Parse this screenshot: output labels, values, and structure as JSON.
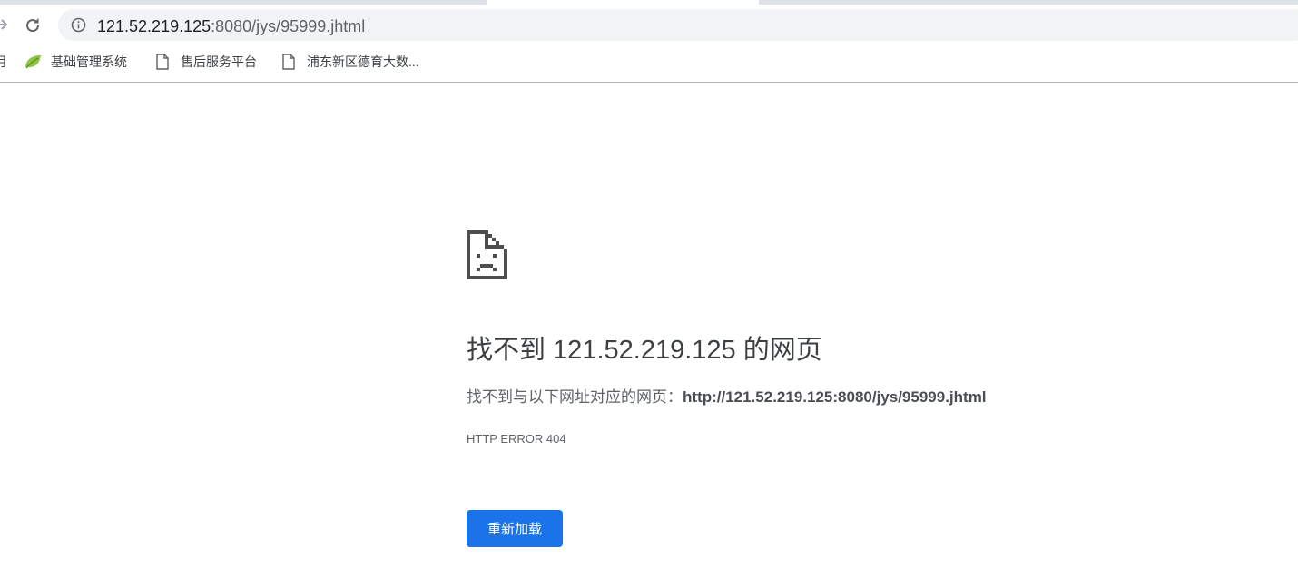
{
  "browser": {
    "url": {
      "host": "121.52.219.125",
      "rest": ":8080/jys/95999.jhtml"
    },
    "bookmarks": {
      "partial_label": "月",
      "items": [
        {
          "label": "基础管理系统",
          "icon": "leaf-icon"
        },
        {
          "label": "售后服务平台",
          "icon": "page-icon"
        },
        {
          "label": "浦东新区德育大数...",
          "icon": "page-icon"
        }
      ]
    }
  },
  "error_page": {
    "icon": "sad-page-icon",
    "title": "找不到 121.52.219.125 的网页",
    "description_prefix": "找不到与以下网址对应的网页：",
    "description_url": "http://121.52.219.125:8080/jys/95999.jhtml",
    "error_code": "HTTP ERROR 404",
    "reload_label": "重新加载",
    "reload_color": "#1a73e8"
  }
}
